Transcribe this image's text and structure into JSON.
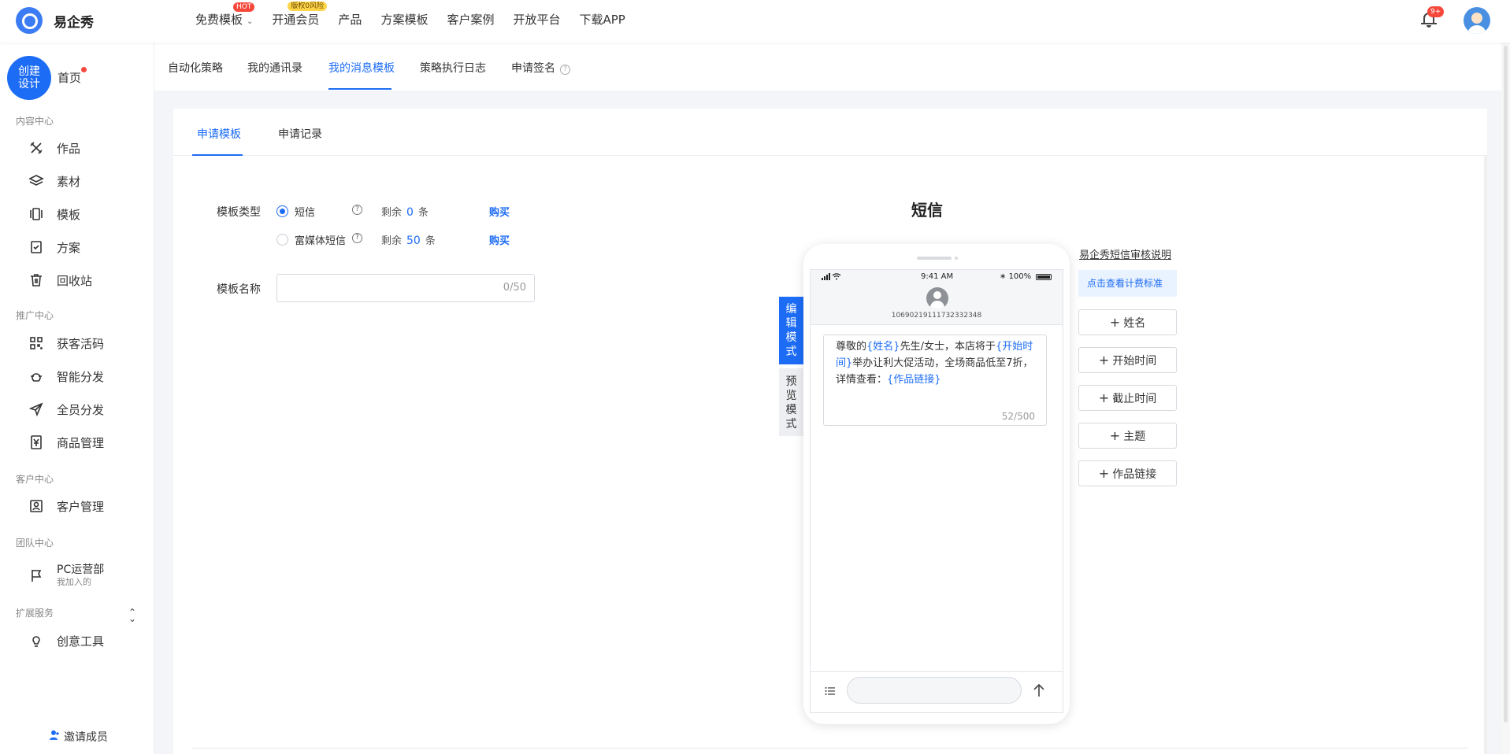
{
  "app": {
    "name": "易企秀",
    "accent": "#1d6cf5"
  },
  "topnav": {
    "items": [
      {
        "label": "免费模板",
        "badge": "HOT"
      },
      {
        "label": "开通会员",
        "badge": "版权0风险"
      },
      {
        "label": "产品"
      },
      {
        "label": "方案模板"
      },
      {
        "label": "客户案例"
      },
      {
        "label": "开放平台"
      },
      {
        "label": "下载APP"
      }
    ],
    "notification_count": "9+"
  },
  "sidebar": {
    "create_label_line1": "创建",
    "create_label_line2": "设计",
    "home": "首页",
    "sections": {
      "content": "内容中心",
      "promo": "推广中心",
      "customer": "客户中心",
      "team": "团队中心",
      "extend": "扩展服务"
    },
    "items": {
      "works": "作品",
      "materials": "素材",
      "templates": "模板",
      "plans": "方案",
      "recycle": "回收站",
      "lead_code": "获客活码",
      "smart_dist": "智能分发",
      "all_dist": "全员分发",
      "goods": "商品管理",
      "customers": "客户管理",
      "creative": "创意工具"
    },
    "team": {
      "name": "PC运营部",
      "sub": "我加入的"
    },
    "invite": "邀请成员"
  },
  "subtabs": [
    "自动化策略",
    "我的通讯录",
    "我的消息模板",
    "策略执行日志",
    "申请签名"
  ],
  "card_tabs": [
    "申请模板",
    "申请记录"
  ],
  "form": {
    "type_label": "模板类型",
    "name_label": "模板名称",
    "options": [
      {
        "label": "短信",
        "remain_prefix": "剩余",
        "remain": "0",
        "remain_suffix": "条",
        "buy": "购买"
      },
      {
        "label": "富媒体短信",
        "remain_prefix": "剩余",
        "remain": "50",
        "remain_suffix": "条",
        "buy": "购买"
      }
    ],
    "name_value": "",
    "name_count": "0/50"
  },
  "preview": {
    "title": "短信",
    "status_time": "9:41 AM",
    "battery": "100%",
    "contact_number": "10690219111732332348",
    "message": {
      "p1": "尊敬的",
      "v1": "{姓名}",
      "p2": "先生/女士，本店将于",
      "v2": "{开始时间}",
      "p3": "举办让利大促活动，全场商品低至7折，详情查看：",
      "v3": "{作品链接}"
    },
    "count": "52/500",
    "mode_edit": "编辑模式",
    "mode_preview": "预览模式"
  },
  "side_panel": {
    "review_link": "易企秀短信审核说明",
    "price_button": "点击查看计费标准",
    "variables": [
      "姓名",
      "开始时间",
      "截止时间",
      "主题",
      "作品链接"
    ]
  }
}
